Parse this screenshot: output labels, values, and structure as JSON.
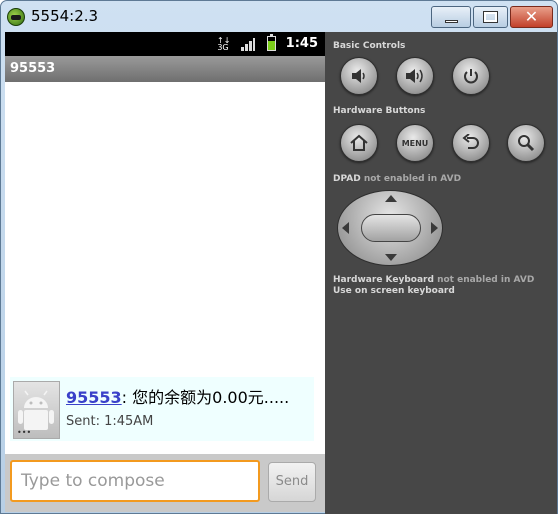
{
  "window": {
    "title": "5554:2.3",
    "minimize_icon": "minimize-icon",
    "maximize_icon": "maximize-icon",
    "close_icon": "close-icon"
  },
  "statusbar": {
    "network": "3G",
    "time": "1:45",
    "battery_level": 0.7
  },
  "thread": {
    "title": "95553",
    "message": {
      "sender": "95553",
      "separator": ": ",
      "body": "您的余额为0.00元.....",
      "status": "Sent: 1:45AM"
    },
    "compose": {
      "placeholder": "Type to compose",
      "send_label": "Send"
    }
  },
  "panel": {
    "basic_controls_label": "Basic Controls",
    "hardware_buttons_label": "Hardware Buttons",
    "menu_label": "MENU",
    "dpad_label": "DPAD",
    "dpad_note": "not enabled in AVD",
    "keyboard_label": "Hardware Keyboard",
    "keyboard_note": "not enabled in AVD",
    "keyboard_hint": "Use on screen keyboard"
  },
  "colors": {
    "accent_orange": "#f39a1f",
    "sender_link": "#3a41c9",
    "panel_bg": "#474747"
  }
}
